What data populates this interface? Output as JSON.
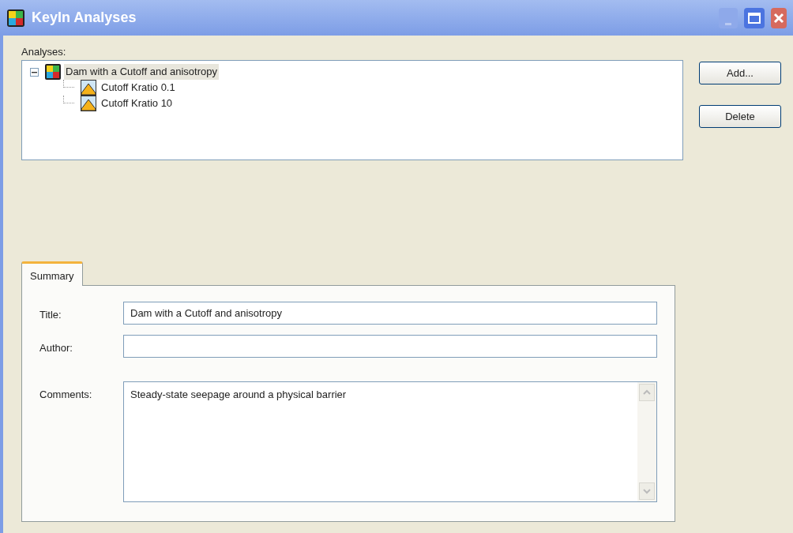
{
  "window": {
    "title": "KeyIn Analyses"
  },
  "analyses": {
    "label": "Analyses:",
    "tree": [
      {
        "label": "Dam with a Cutoff and anisotropy",
        "kind": "project",
        "expanded": true,
        "selected": true,
        "children": [
          {
            "label": "Cutoff Kratio 0.1",
            "kind": "analysis",
            "selected": false
          },
          {
            "label": "Cutoff Kratio 10",
            "kind": "analysis",
            "selected": false
          }
        ]
      }
    ]
  },
  "buttons": [
    "Add...",
    "Delete"
  ],
  "tabs": [
    {
      "label": "Summary",
      "selected": true
    }
  ],
  "summary": {
    "fields": [
      {
        "label": "Title:",
        "value": "Dam with a Cutoff and anisotropy",
        "kind": "line"
      },
      {
        "label": "Author:",
        "kind": "line"
      },
      {
        "label": "Comments:",
        "value": "Steady-state seepage around a physical barrier",
        "kind": "multiline"
      }
    ]
  }
}
